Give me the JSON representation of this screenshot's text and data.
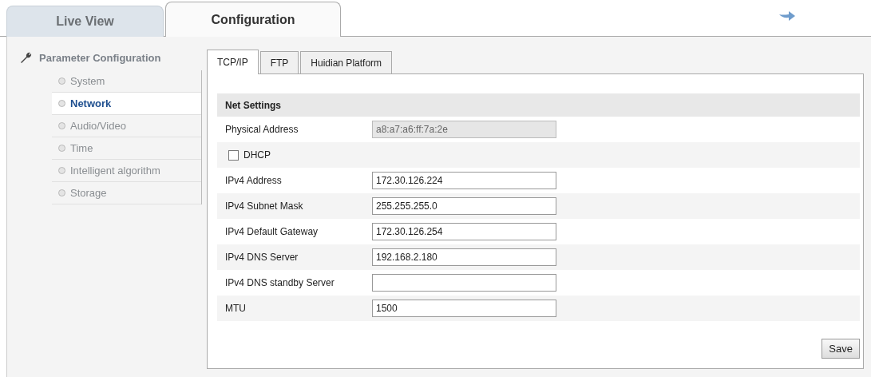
{
  "main_tabs": [
    {
      "label": "Live View",
      "selected": false
    },
    {
      "label": "Configuration",
      "selected": true
    }
  ],
  "sidebar": {
    "title": "Parameter Configuration",
    "items": [
      {
        "label": "System",
        "selected": false
      },
      {
        "label": "Network",
        "selected": true
      },
      {
        "label": "Audio/Video",
        "selected": false
      },
      {
        "label": "Time",
        "selected": false
      },
      {
        "label": "Intelligent algorithm",
        "selected": false
      },
      {
        "label": "Storage",
        "selected": false
      }
    ]
  },
  "sub_tabs": [
    {
      "label": "TCP/IP",
      "selected": true
    },
    {
      "label": "FTP",
      "selected": false
    },
    {
      "label": "Huidian Platform",
      "selected": false
    }
  ],
  "section_title": "Net Settings",
  "fields": [
    {
      "kind": "text",
      "label": "Physical Address",
      "value": "a8:a7:a6:ff:7a:2e",
      "disabled": true
    },
    {
      "kind": "checkbox",
      "label": "DHCP",
      "checked": false
    },
    {
      "kind": "text",
      "label": "IPv4 Address",
      "value": "172.30.126.224",
      "disabled": false
    },
    {
      "kind": "text",
      "label": "IPv4 Subnet Mask",
      "value": "255.255.255.0",
      "disabled": false
    },
    {
      "kind": "text",
      "label": "IPv4 Default Gateway",
      "value": "172.30.126.254",
      "disabled": false
    },
    {
      "kind": "text",
      "label": "IPv4 DNS Server",
      "value": "192.168.2.180",
      "disabled": false
    },
    {
      "kind": "text",
      "label": "IPv4 DNS standby Server",
      "disabled": false
    },
    {
      "kind": "text",
      "label": "MTU",
      "value": "1500",
      "disabled": false
    }
  ],
  "save_button": "Save"
}
